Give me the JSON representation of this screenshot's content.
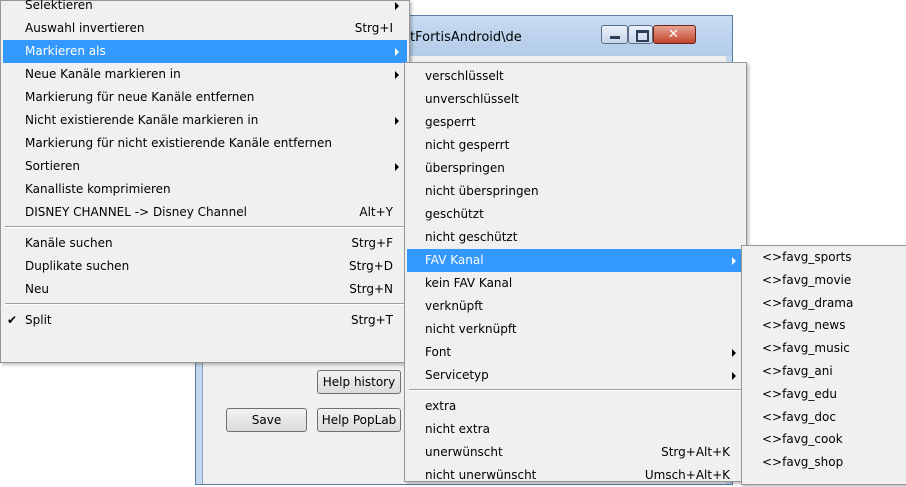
{
  "window": {
    "title": "tFortisAndroid\\de",
    "buttons": {
      "save": "Save",
      "help_history": "Help history",
      "help_poplab": "Help PopLab"
    }
  },
  "menu_main": {
    "items": [
      {
        "label": "Selektieren",
        "shortcut": "",
        "submenu": true
      },
      {
        "label": "Auswahl invertieren",
        "shortcut": "Strg+I"
      },
      {
        "label": "Markieren als",
        "shortcut": "",
        "submenu": true,
        "highlighted": true
      },
      {
        "label": "Neue Kanäle markieren in",
        "shortcut": "",
        "submenu": true
      },
      {
        "label": "Markierung für neue Kanäle entfernen",
        "shortcut": ""
      },
      {
        "label": "Nicht existierende Kanäle markieren in",
        "shortcut": "",
        "submenu": true
      },
      {
        "label": "Markierung für nicht existierende Kanäle entfernen",
        "shortcut": ""
      },
      {
        "label": "Sortieren",
        "shortcut": "",
        "submenu": true
      },
      {
        "label": "Kanalliste komprimieren",
        "shortcut": ""
      },
      {
        "label": "DISNEY CHANNEL -> Disney Channel",
        "shortcut": "Alt+Y"
      },
      {
        "label": "Kanäle suchen",
        "shortcut": "Strg+F"
      },
      {
        "label": "Duplikate suchen",
        "shortcut": "Strg+D"
      },
      {
        "label": "Neu",
        "shortcut": "Strg+N"
      },
      {
        "label": "Split",
        "shortcut": "Strg+T",
        "checked": true,
        "check_glyph": "✔"
      }
    ]
  },
  "menu_markieren": {
    "items": [
      {
        "label": "verschlüsselt",
        "shortcut": ""
      },
      {
        "label": "unverschlüsselt",
        "shortcut": ""
      },
      {
        "label": "gesperrt",
        "shortcut": ""
      },
      {
        "label": "nicht gesperrt",
        "shortcut": ""
      },
      {
        "label": "überspringen",
        "shortcut": ""
      },
      {
        "label": "nicht überspringen",
        "shortcut": ""
      },
      {
        "label": "geschützt",
        "shortcut": ""
      },
      {
        "label": "nicht geschützt",
        "shortcut": ""
      },
      {
        "label": "FAV Kanal",
        "shortcut": "",
        "submenu": true,
        "highlighted": true
      },
      {
        "label": "kein FAV Kanal",
        "shortcut": ""
      },
      {
        "label": "verknüpft",
        "shortcut": ""
      },
      {
        "label": "nicht verknüpft",
        "shortcut": ""
      },
      {
        "label": "Font",
        "shortcut": "",
        "submenu": true
      },
      {
        "label": "Servicetyp",
        "shortcut": "",
        "submenu": true
      },
      {
        "label": "extra",
        "shortcut": ""
      },
      {
        "label": "nicht extra",
        "shortcut": ""
      },
      {
        "label": "unerwünscht",
        "shortcut": "Strg+Alt+K"
      },
      {
        "label": "nicht unerwünscht",
        "shortcut": "Umsch+Alt+K"
      }
    ]
  },
  "menu_fav": {
    "items": [
      {
        "label": "<>favg_sports"
      },
      {
        "label": "<>favg_movie"
      },
      {
        "label": "<>favg_drama"
      },
      {
        "label": "<>favg_news"
      },
      {
        "label": "<>favg_music"
      },
      {
        "label": "<>favg_ani"
      },
      {
        "label": "<>favg_edu"
      },
      {
        "label": "<>favg_doc"
      },
      {
        "label": "<>favg_cook"
      },
      {
        "label": "<>favg_shop"
      }
    ]
  },
  "colors": {
    "highlight": "#3399ff",
    "menu_bg": "#f0f0f0",
    "window_frame": "#c3d7ee"
  }
}
